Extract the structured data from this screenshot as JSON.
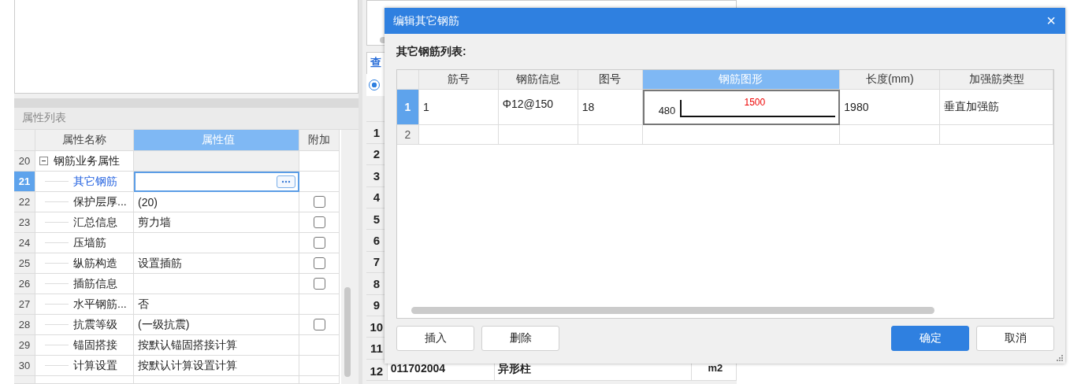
{
  "property_panel": {
    "title": "属性列表",
    "columns": [
      "属性名称",
      "属性值",
      "附加"
    ],
    "rows": [
      {
        "index": "20",
        "kind": "group",
        "name": "钢筋业务属性",
        "expanded": true,
        "selected": false
      },
      {
        "index": "21",
        "kind": "editor",
        "name": "其它钢筋",
        "selected": true
      },
      {
        "index": "22",
        "kind": "check",
        "name": "保护层厚...",
        "value": "(20)",
        "checked": false,
        "selected": false
      },
      {
        "index": "23",
        "kind": "check",
        "name": "汇总信息",
        "value": "剪力墙",
        "checked": false,
        "selected": false
      },
      {
        "index": "24",
        "kind": "check",
        "name": "压墙筋",
        "checked": false,
        "selected": false
      },
      {
        "index": "25",
        "kind": "check",
        "name": "纵筋构造",
        "value": "设置插筋",
        "checked": false,
        "selected": false
      },
      {
        "index": "26",
        "kind": "check",
        "name": "插筋信息",
        "checked": false,
        "selected": false
      },
      {
        "index": "27",
        "kind": "plain",
        "name": "水平钢筋...",
        "value": "否",
        "selected": false
      },
      {
        "index": "28",
        "kind": "check",
        "name": "抗震等级",
        "value": "(一级抗震)",
        "checked": false,
        "selected": false
      },
      {
        "index": "29",
        "kind": "plain",
        "name": "锚固搭接",
        "value": "按默认锚固搭接计算",
        "selected": false
      },
      {
        "index": "30",
        "kind": "plain",
        "name": "计算设置",
        "value": "按默认计算设置计算",
        "selected": false
      }
    ]
  },
  "query_panel": {
    "tab": "查",
    "radio": {
      "selected": true
    },
    "row_numbers": [
      "1",
      "2",
      "3",
      "4",
      "5",
      "6",
      "7",
      "8",
      "9",
      "10",
      "11"
    ],
    "rows": [
      {
        "index": "12",
        "cells": [
          "011702004",
          "异形柱",
          "m2"
        ]
      }
    ]
  },
  "dialog": {
    "title": "编辑其它钢筋",
    "close": "×",
    "list_label": "其它钢筋列表:",
    "columns": [
      {
        "label": "筋号",
        "selected": false
      },
      {
        "label": "钢筋信息",
        "selected": false
      },
      {
        "label": "图号",
        "selected": false
      },
      {
        "label": "钢筋图形",
        "selected": true
      },
      {
        "label": "长度(mm)",
        "selected": false
      },
      {
        "label": "加强筋类型",
        "selected": false
      }
    ],
    "rows": [
      {
        "index": "1",
        "selected": true,
        "bar_no": "1",
        "info": "Φ12@150",
        "shape_no": "18",
        "shape": {
          "leg": "480",
          "length": "1500"
        },
        "length": "1980",
        "type": "垂直加强筋"
      },
      {
        "index": "2",
        "selected": false
      }
    ],
    "buttons": [
      {
        "label": "插入",
        "kind": "default"
      },
      {
        "label": "删除",
        "kind": "default"
      },
      {
        "label": "确定",
        "kind": "primary"
      },
      {
        "label": "取消",
        "kind": "default"
      }
    ]
  }
}
